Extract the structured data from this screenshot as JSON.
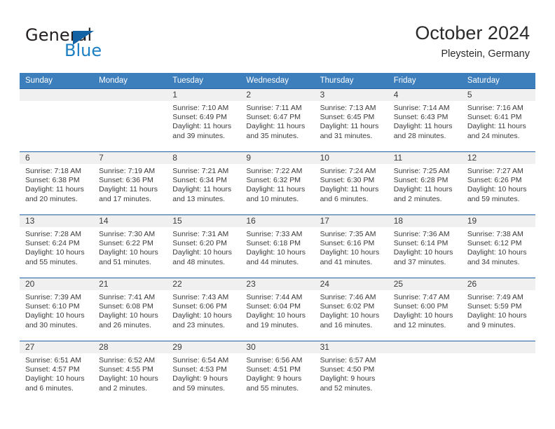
{
  "brand": {
    "name_top": "General",
    "name_bottom": "Blue",
    "accent_color": "#1c7fc4",
    "triangle_color": "#1362a4"
  },
  "header": {
    "title": "October 2024",
    "subtitle": "Pleystein, Germany"
  },
  "theme": {
    "header_bg": "#3d7ebc",
    "row_rule": "#1f5fa3",
    "daynum_bg": "#f0f0f0",
    "text": "#3a3a3a"
  },
  "weekdays": [
    "Sunday",
    "Monday",
    "Tuesday",
    "Wednesday",
    "Thursday",
    "Friday",
    "Saturday"
  ],
  "weeks": [
    [
      {
        "day": "",
        "sunrise": "",
        "sunset": "",
        "daylight_line1": "",
        "daylight_line2": ""
      },
      {
        "day": "",
        "sunrise": "",
        "sunset": "",
        "daylight_line1": "",
        "daylight_line2": ""
      },
      {
        "day": "1",
        "sunrise": "Sunrise: 7:10 AM",
        "sunset": "Sunset: 6:49 PM",
        "daylight_line1": "Daylight: 11 hours",
        "daylight_line2": "and 39 minutes."
      },
      {
        "day": "2",
        "sunrise": "Sunrise: 7:11 AM",
        "sunset": "Sunset: 6:47 PM",
        "daylight_line1": "Daylight: 11 hours",
        "daylight_line2": "and 35 minutes."
      },
      {
        "day": "3",
        "sunrise": "Sunrise: 7:13 AM",
        "sunset": "Sunset: 6:45 PM",
        "daylight_line1": "Daylight: 11 hours",
        "daylight_line2": "and 31 minutes."
      },
      {
        "day": "4",
        "sunrise": "Sunrise: 7:14 AM",
        "sunset": "Sunset: 6:43 PM",
        "daylight_line1": "Daylight: 11 hours",
        "daylight_line2": "and 28 minutes."
      },
      {
        "day": "5",
        "sunrise": "Sunrise: 7:16 AM",
        "sunset": "Sunset: 6:41 PM",
        "daylight_line1": "Daylight: 11 hours",
        "daylight_line2": "and 24 minutes."
      }
    ],
    [
      {
        "day": "6",
        "sunrise": "Sunrise: 7:18 AM",
        "sunset": "Sunset: 6:38 PM",
        "daylight_line1": "Daylight: 11 hours",
        "daylight_line2": "and 20 minutes."
      },
      {
        "day": "7",
        "sunrise": "Sunrise: 7:19 AM",
        "sunset": "Sunset: 6:36 PM",
        "daylight_line1": "Daylight: 11 hours",
        "daylight_line2": "and 17 minutes."
      },
      {
        "day": "8",
        "sunrise": "Sunrise: 7:21 AM",
        "sunset": "Sunset: 6:34 PM",
        "daylight_line1": "Daylight: 11 hours",
        "daylight_line2": "and 13 minutes."
      },
      {
        "day": "9",
        "sunrise": "Sunrise: 7:22 AM",
        "sunset": "Sunset: 6:32 PM",
        "daylight_line1": "Daylight: 11 hours",
        "daylight_line2": "and 10 minutes."
      },
      {
        "day": "10",
        "sunrise": "Sunrise: 7:24 AM",
        "sunset": "Sunset: 6:30 PM",
        "daylight_line1": "Daylight: 11 hours",
        "daylight_line2": "and 6 minutes."
      },
      {
        "day": "11",
        "sunrise": "Sunrise: 7:25 AM",
        "sunset": "Sunset: 6:28 PM",
        "daylight_line1": "Daylight: 11 hours",
        "daylight_line2": "and 2 minutes."
      },
      {
        "day": "12",
        "sunrise": "Sunrise: 7:27 AM",
        "sunset": "Sunset: 6:26 PM",
        "daylight_line1": "Daylight: 10 hours",
        "daylight_line2": "and 59 minutes."
      }
    ],
    [
      {
        "day": "13",
        "sunrise": "Sunrise: 7:28 AM",
        "sunset": "Sunset: 6:24 PM",
        "daylight_line1": "Daylight: 10 hours",
        "daylight_line2": "and 55 minutes."
      },
      {
        "day": "14",
        "sunrise": "Sunrise: 7:30 AM",
        "sunset": "Sunset: 6:22 PM",
        "daylight_line1": "Daylight: 10 hours",
        "daylight_line2": "and 51 minutes."
      },
      {
        "day": "15",
        "sunrise": "Sunrise: 7:31 AM",
        "sunset": "Sunset: 6:20 PM",
        "daylight_line1": "Daylight: 10 hours",
        "daylight_line2": "and 48 minutes."
      },
      {
        "day": "16",
        "sunrise": "Sunrise: 7:33 AM",
        "sunset": "Sunset: 6:18 PM",
        "daylight_line1": "Daylight: 10 hours",
        "daylight_line2": "and 44 minutes."
      },
      {
        "day": "17",
        "sunrise": "Sunrise: 7:35 AM",
        "sunset": "Sunset: 6:16 PM",
        "daylight_line1": "Daylight: 10 hours",
        "daylight_line2": "and 41 minutes."
      },
      {
        "day": "18",
        "sunrise": "Sunrise: 7:36 AM",
        "sunset": "Sunset: 6:14 PM",
        "daylight_line1": "Daylight: 10 hours",
        "daylight_line2": "and 37 minutes."
      },
      {
        "day": "19",
        "sunrise": "Sunrise: 7:38 AM",
        "sunset": "Sunset: 6:12 PM",
        "daylight_line1": "Daylight: 10 hours",
        "daylight_line2": "and 34 minutes."
      }
    ],
    [
      {
        "day": "20",
        "sunrise": "Sunrise: 7:39 AM",
        "sunset": "Sunset: 6:10 PM",
        "daylight_line1": "Daylight: 10 hours",
        "daylight_line2": "and 30 minutes."
      },
      {
        "day": "21",
        "sunrise": "Sunrise: 7:41 AM",
        "sunset": "Sunset: 6:08 PM",
        "daylight_line1": "Daylight: 10 hours",
        "daylight_line2": "and 26 minutes."
      },
      {
        "day": "22",
        "sunrise": "Sunrise: 7:43 AM",
        "sunset": "Sunset: 6:06 PM",
        "daylight_line1": "Daylight: 10 hours",
        "daylight_line2": "and 23 minutes."
      },
      {
        "day": "23",
        "sunrise": "Sunrise: 7:44 AM",
        "sunset": "Sunset: 6:04 PM",
        "daylight_line1": "Daylight: 10 hours",
        "daylight_line2": "and 19 minutes."
      },
      {
        "day": "24",
        "sunrise": "Sunrise: 7:46 AM",
        "sunset": "Sunset: 6:02 PM",
        "daylight_line1": "Daylight: 10 hours",
        "daylight_line2": "and 16 minutes."
      },
      {
        "day": "25",
        "sunrise": "Sunrise: 7:47 AM",
        "sunset": "Sunset: 6:00 PM",
        "daylight_line1": "Daylight: 10 hours",
        "daylight_line2": "and 12 minutes."
      },
      {
        "day": "26",
        "sunrise": "Sunrise: 7:49 AM",
        "sunset": "Sunset: 5:59 PM",
        "daylight_line1": "Daylight: 10 hours",
        "daylight_line2": "and 9 minutes."
      }
    ],
    [
      {
        "day": "27",
        "sunrise": "Sunrise: 6:51 AM",
        "sunset": "Sunset: 4:57 PM",
        "daylight_line1": "Daylight: 10 hours",
        "daylight_line2": "and 6 minutes."
      },
      {
        "day": "28",
        "sunrise": "Sunrise: 6:52 AM",
        "sunset": "Sunset: 4:55 PM",
        "daylight_line1": "Daylight: 10 hours",
        "daylight_line2": "and 2 minutes."
      },
      {
        "day": "29",
        "sunrise": "Sunrise: 6:54 AM",
        "sunset": "Sunset: 4:53 PM",
        "daylight_line1": "Daylight: 9 hours",
        "daylight_line2": "and 59 minutes."
      },
      {
        "day": "30",
        "sunrise": "Sunrise: 6:56 AM",
        "sunset": "Sunset: 4:51 PM",
        "daylight_line1": "Daylight: 9 hours",
        "daylight_line2": "and 55 minutes."
      },
      {
        "day": "31",
        "sunrise": "Sunrise: 6:57 AM",
        "sunset": "Sunset: 4:50 PM",
        "daylight_line1": "Daylight: 9 hours",
        "daylight_line2": "and 52 minutes."
      },
      {
        "day": "",
        "sunrise": "",
        "sunset": "",
        "daylight_line1": "",
        "daylight_line2": ""
      },
      {
        "day": "",
        "sunrise": "",
        "sunset": "",
        "daylight_line1": "",
        "daylight_line2": ""
      }
    ]
  ]
}
